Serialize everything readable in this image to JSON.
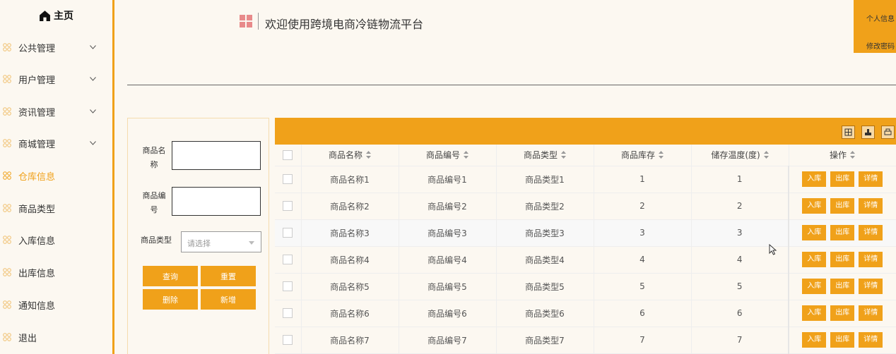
{
  "sidebar": {
    "brand_label": "主页",
    "items": [
      {
        "label": "公共管理",
        "expandable": true,
        "active": false
      },
      {
        "label": "用户管理",
        "expandable": true,
        "active": false
      },
      {
        "label": "资讯管理",
        "expandable": true,
        "active": false
      },
      {
        "label": "商城管理",
        "expandable": true,
        "active": false
      },
      {
        "label": "仓库信息",
        "expandable": false,
        "active": true
      },
      {
        "label": "商品类型",
        "expandable": false,
        "active": false
      },
      {
        "label": "入库信息",
        "expandable": false,
        "active": false
      },
      {
        "label": "出库信息",
        "expandable": false,
        "active": false
      },
      {
        "label": "通知信息",
        "expandable": false,
        "active": false
      },
      {
        "label": "退出",
        "expandable": false,
        "active": false
      }
    ]
  },
  "header": {
    "title": "欢迎使用跨境电商冷链物流平台",
    "personal_info": "个人信息",
    "change_password": "修改密码"
  },
  "search": {
    "name_label": "商品名称",
    "code_label": "商品编号",
    "type_label": "商品类型",
    "type_placeholder": "请选择",
    "query_button": "查询",
    "reset_button": "重置",
    "delete_button": "删除",
    "add_button": "新增"
  },
  "table": {
    "columns": [
      "商品名称",
      "商品编号",
      "商品类型",
      "商品库存",
      "储存温度(度)",
      "操作"
    ],
    "row_actions": [
      "入库",
      "出库",
      "详情"
    ],
    "rows": [
      [
        "商品名称1",
        "商品编号1",
        "商品类型1",
        "1",
        "1"
      ],
      [
        "商品名称2",
        "商品编号2",
        "商品类型2",
        "2",
        "2"
      ],
      [
        "商品名称3",
        "商品编号3",
        "商品类型3",
        "3",
        "3"
      ],
      [
        "商品名称4",
        "商品编号4",
        "商品类型4",
        "4",
        "4"
      ],
      [
        "商品名称5",
        "商品编号5",
        "商品类型5",
        "5",
        "5"
      ],
      [
        "商品名称6",
        "商品编号6",
        "商品类型6",
        "6",
        "6"
      ],
      [
        "商品名称7",
        "商品编号7",
        "商品类型7",
        "7",
        "7"
      ]
    ]
  },
  "colors": {
    "accent": "#f0a11a",
    "background": "#fcf8f1"
  }
}
